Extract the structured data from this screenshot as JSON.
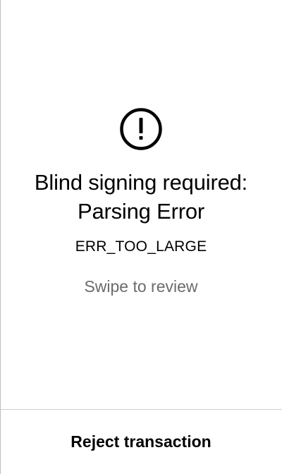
{
  "main": {
    "icon": "warning-circle-icon",
    "title_line1": "Blind signing required:",
    "title_line2": "Parsing Error",
    "error_code": "ERR_TOO_LARGE",
    "swipe_hint": "Swipe to review"
  },
  "footer": {
    "reject_label": "Reject transaction"
  }
}
